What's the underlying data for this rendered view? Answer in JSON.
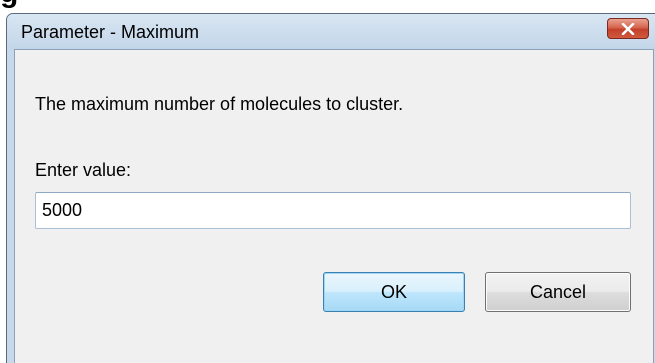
{
  "window": {
    "title": "Parameter - Maximum"
  },
  "dialog": {
    "description": "The maximum number of molecules to cluster.",
    "input_label": "Enter value:",
    "input_value": "5000",
    "ok_label": "OK",
    "cancel_label": "Cancel"
  },
  "icons": {
    "close": "close-icon"
  },
  "colors": {
    "close_button": "#c9452f",
    "ok_border": "#3c7fb1",
    "dialog_background": "#f0f0f0"
  }
}
